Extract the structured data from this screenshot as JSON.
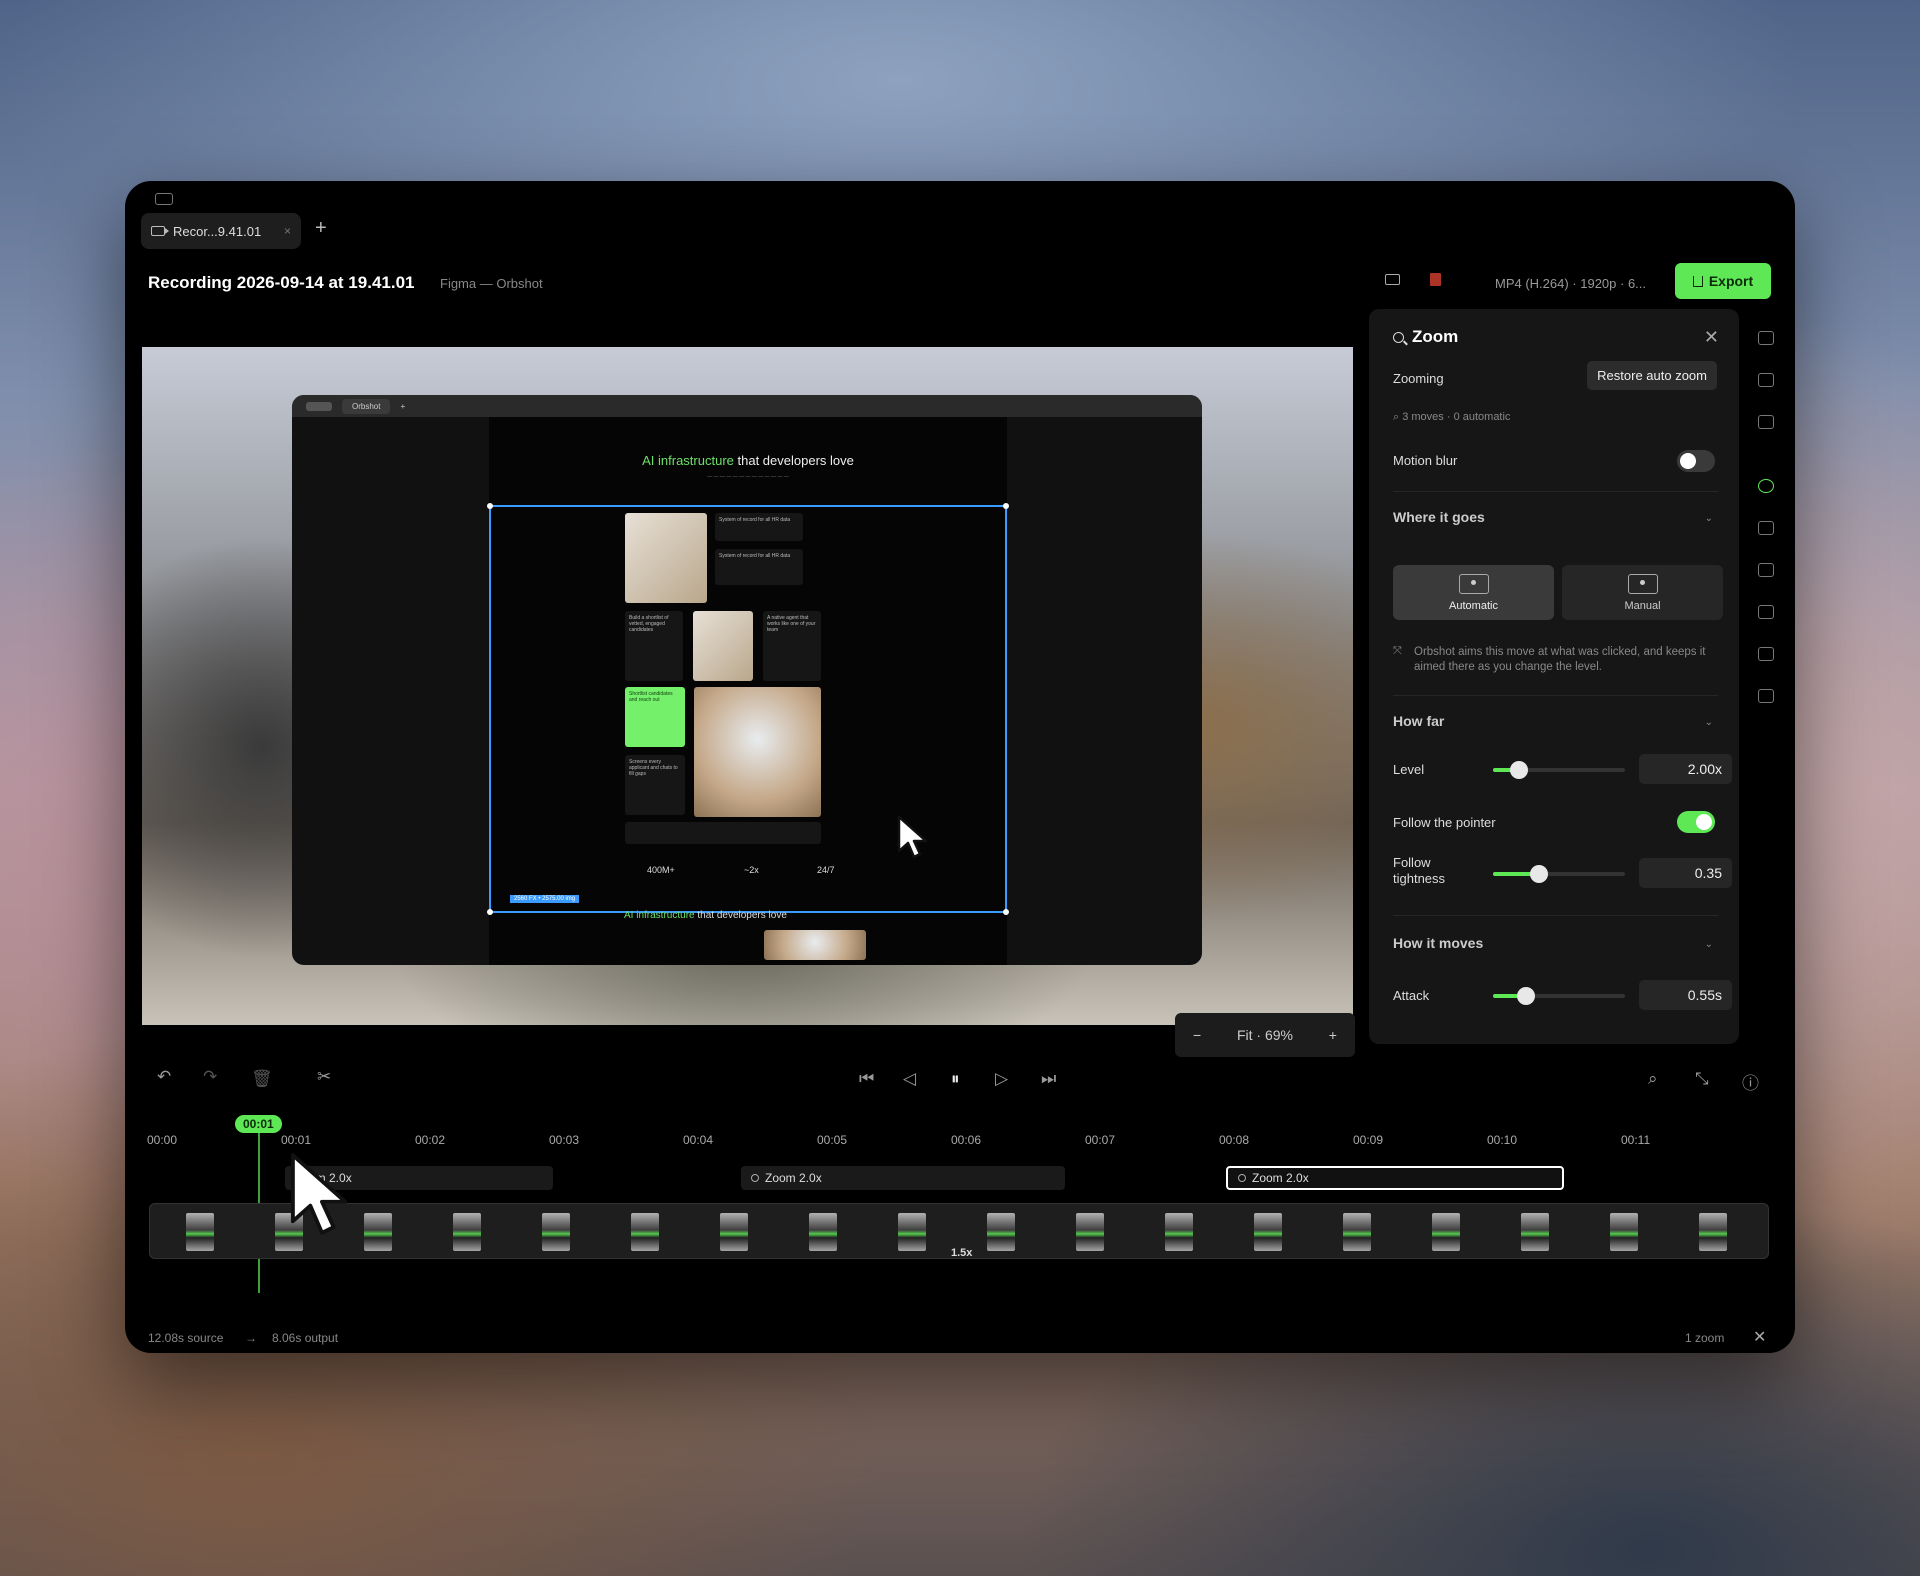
{
  "tab": {
    "label": "Recor...9.41.01"
  },
  "header": {
    "title": "Recording 2026-09-14 at 19.41.01",
    "subtitle": "Figma — Orbshot",
    "format": "MP4 (H.264) · 1920p · 6...",
    "export_label": "Export"
  },
  "preview": {
    "inner_tab": "Orbshot",
    "headline_accent": "AI infrastructure",
    "headline_rest": "that developers love",
    "selection_label": "2560 FX • 2575.00 img",
    "stats": [
      "400M+",
      "~2x",
      "24/7"
    ],
    "footer_accent": "AI infrastructure",
    "footer_rest": "that developers love",
    "zoom_fit": "Fit · 69%",
    "zoom_minus": "−",
    "zoom_plus": "+"
  },
  "panel": {
    "title": "Zoom",
    "zooming_label": "Zooming",
    "restore_label": "Restore auto zoom",
    "moves_text": "3 moves · 0 automatic",
    "motion_blur_label": "Motion blur",
    "motion_blur_on": false,
    "where_title": "Where it goes",
    "mode_automatic": "Automatic",
    "mode_manual": "Manual",
    "note": "Orbshot aims this move at what was clicked, and keeps it aimed there as you change the level.",
    "how_far_title": "How far",
    "level_label": "Level",
    "level_value": "2.00x",
    "level_fraction": 0.2,
    "follow_label": "Follow the pointer",
    "follow_on": true,
    "tightness_label": "Follow tightness",
    "tightness_value": "0.35",
    "tightness_fraction": 0.35,
    "how_moves_title": "How it moves",
    "attack_label": "Attack",
    "attack_value": "0.55s",
    "attack_fraction": 0.25
  },
  "timeline": {
    "playhead": "00:01",
    "ticks": [
      "00:00",
      "00:01",
      "00:02",
      "00:03",
      "00:04",
      "00:05",
      "00:06",
      "00:07",
      "00:08",
      "00:09",
      "00:10",
      "00:11"
    ],
    "segments": [
      "Zoom 2.0x",
      "Zoom 2.0x",
      "Zoom 2.0x"
    ],
    "speed": "1.5x"
  },
  "footer": {
    "source": "12.08s source",
    "arrow": "→",
    "output": "8.06s output",
    "zoom_count": "1 zoom"
  },
  "colors": {
    "accent": "#5ee856",
    "selection": "#3b9cff"
  }
}
